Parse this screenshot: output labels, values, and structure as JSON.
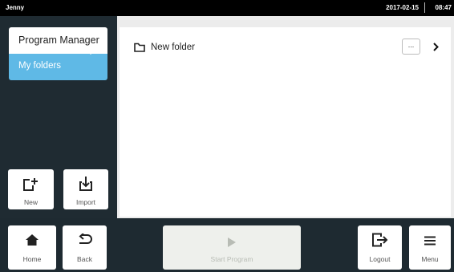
{
  "status_bar": {
    "user": "Jenny",
    "date": "2017-02-15",
    "time": "08:47"
  },
  "sidebar": {
    "tab_title": "Program Manager",
    "selected_item": "My folders",
    "new_label": "New",
    "import_label": "Import"
  },
  "main": {
    "items": [
      {
        "name": "New folder",
        "more_label": "...",
        "icon": "folder-icon"
      }
    ]
  },
  "bottom_bar": {
    "home_label": "Home",
    "back_label": "Back",
    "start_label": "Start Program",
    "logout_label": "Logout",
    "menu_label": "Menu"
  },
  "colors": {
    "accent": "#5fb9e6",
    "dark_background": "#1e2a31",
    "status_bar": "#000000",
    "disabled_button": "#eef0ec"
  }
}
